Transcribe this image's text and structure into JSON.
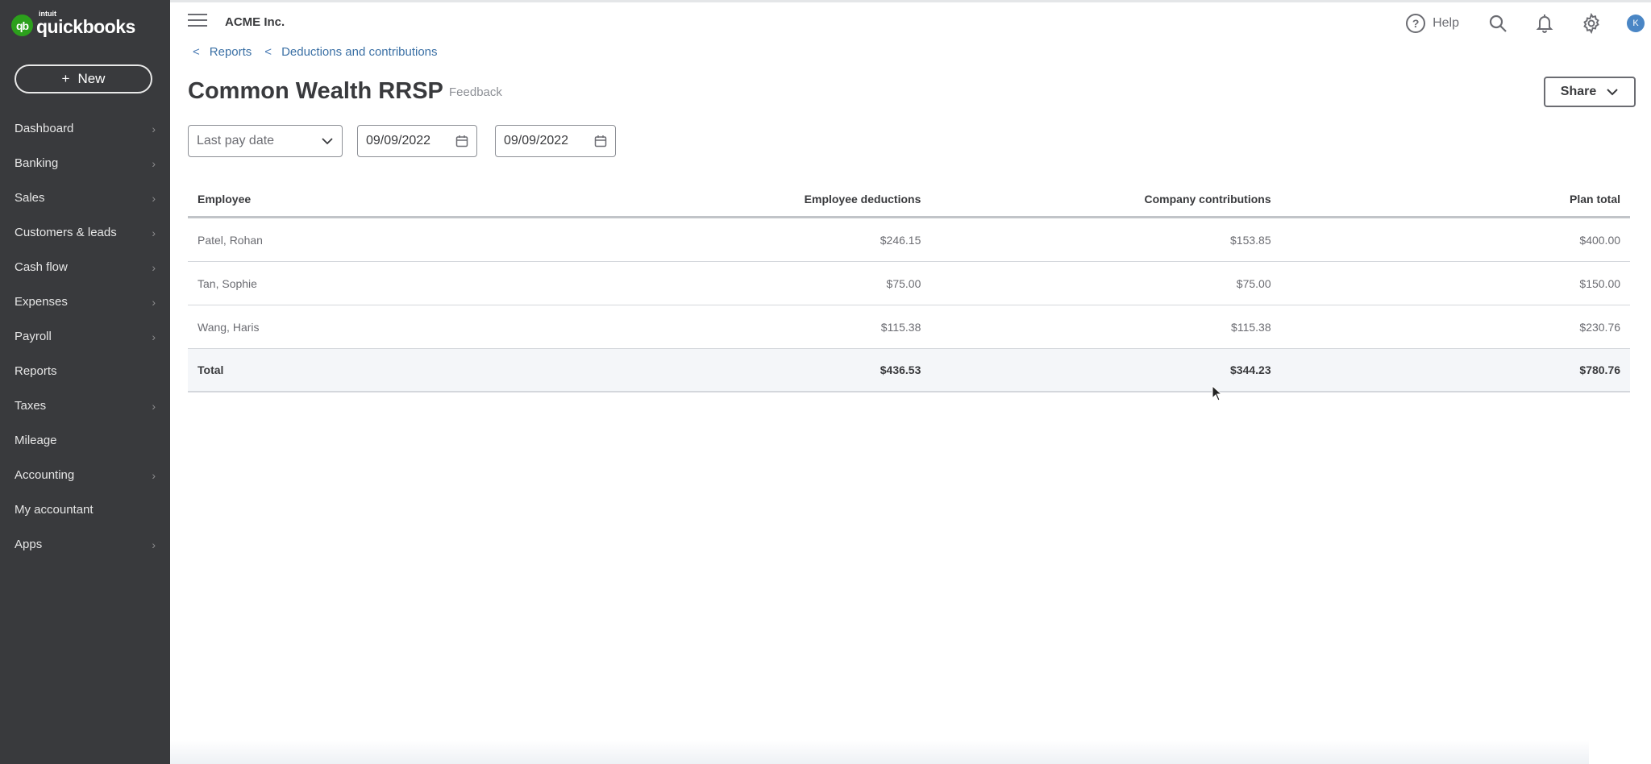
{
  "brand": {
    "logo_badge": "qb",
    "logo_small": "intuit",
    "logo_word": "quickbooks",
    "accent_color": "#2ca01c"
  },
  "sidebar": {
    "new_button": {
      "icon": "plus-icon",
      "label": "New"
    },
    "items": [
      {
        "label": "Dashboard",
        "has_submenu": true
      },
      {
        "label": "Banking",
        "has_submenu": true
      },
      {
        "label": "Sales",
        "has_submenu": true
      },
      {
        "label": "Customers & leads",
        "has_submenu": true
      },
      {
        "label": "Cash flow",
        "has_submenu": true
      },
      {
        "label": "Expenses",
        "has_submenu": true
      },
      {
        "label": "Payroll",
        "has_submenu": true
      },
      {
        "label": "Reports",
        "has_submenu": false
      },
      {
        "label": "Taxes",
        "has_submenu": true
      },
      {
        "label": "Mileage",
        "has_submenu": false
      },
      {
        "label": "Accounting",
        "has_submenu": true
      },
      {
        "label": "My accountant",
        "has_submenu": false
      },
      {
        "label": "Apps",
        "has_submenu": true
      }
    ]
  },
  "header": {
    "company_name": "ACME Inc.",
    "help_label": "Help",
    "help_icon_glyph": "?",
    "avatar_initial": "K",
    "avatar_color": "#4a86c5"
  },
  "breadcrumb": {
    "items": [
      {
        "label": "Reports"
      },
      {
        "label": "Deductions and contributions"
      }
    ],
    "separator_glyph": "<"
  },
  "page": {
    "title": "Common Wealth RRSP",
    "feedback_label": "Feedback",
    "share_label": "Share"
  },
  "filters": {
    "date_type": {
      "selected": "Last pay date"
    },
    "start_date": {
      "value": "09/09/2022"
    },
    "end_date": {
      "value": "09/09/2022"
    }
  },
  "table": {
    "columns": [
      "Employee",
      "Employee deductions",
      "Company contributions",
      "Plan total"
    ],
    "rows": [
      [
        "Patel, Rohan",
        "$246.15",
        "$153.85",
        "$400.00"
      ],
      [
        "Tan, Sophie",
        "$75.00",
        "$75.00",
        "$150.00"
      ],
      [
        "Wang, Haris",
        "$115.38",
        "$115.38",
        "$230.76"
      ]
    ],
    "total": [
      "Total",
      "$436.53",
      "$344.23",
      "$780.76"
    ]
  }
}
